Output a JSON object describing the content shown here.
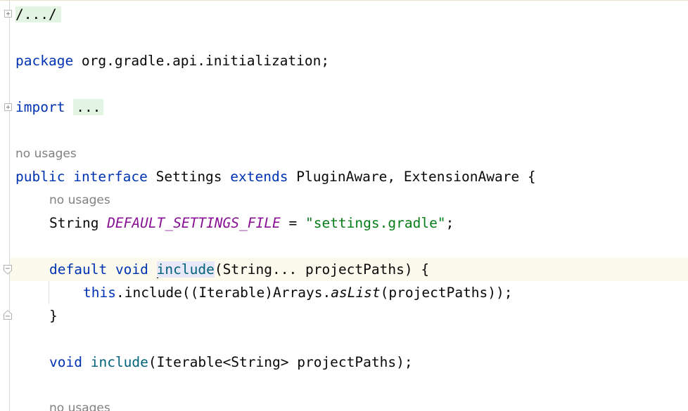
{
  "editor": {
    "lines": {
      "header_fold": "/.../",
      "package_kw": "package",
      "package_name": " org.gradle.api.initialization;",
      "import_kw": "import",
      "import_fold": "...",
      "usages_1": "no usages",
      "decl_public": "public",
      "decl_interface": "interface",
      "decl_name": " Settings ",
      "decl_extends": "extends",
      "decl_rest": " PluginAware, ExtensionAware {",
      "usages_2": "no usages",
      "field_type": "String ",
      "field_name": "DEFAULT_SETTINGS_FILE",
      "field_eq": " = ",
      "field_value": "\"settings.gradle\"",
      "field_end": ";",
      "m1_default": "default",
      "m1_void": "void",
      "m1_name": "include",
      "m1_rest": "(String... projectPaths) {",
      "body_this": "this",
      "body_mid": ".include((Iterable)Arrays.",
      "body_aslist": "asList",
      "body_end": "(projectPaths));",
      "close_brace": "}",
      "m2_void": "void",
      "m2_name": "include",
      "m2_rest": "(Iterable<String> projectPaths);",
      "usages_3": "no usages"
    }
  }
}
